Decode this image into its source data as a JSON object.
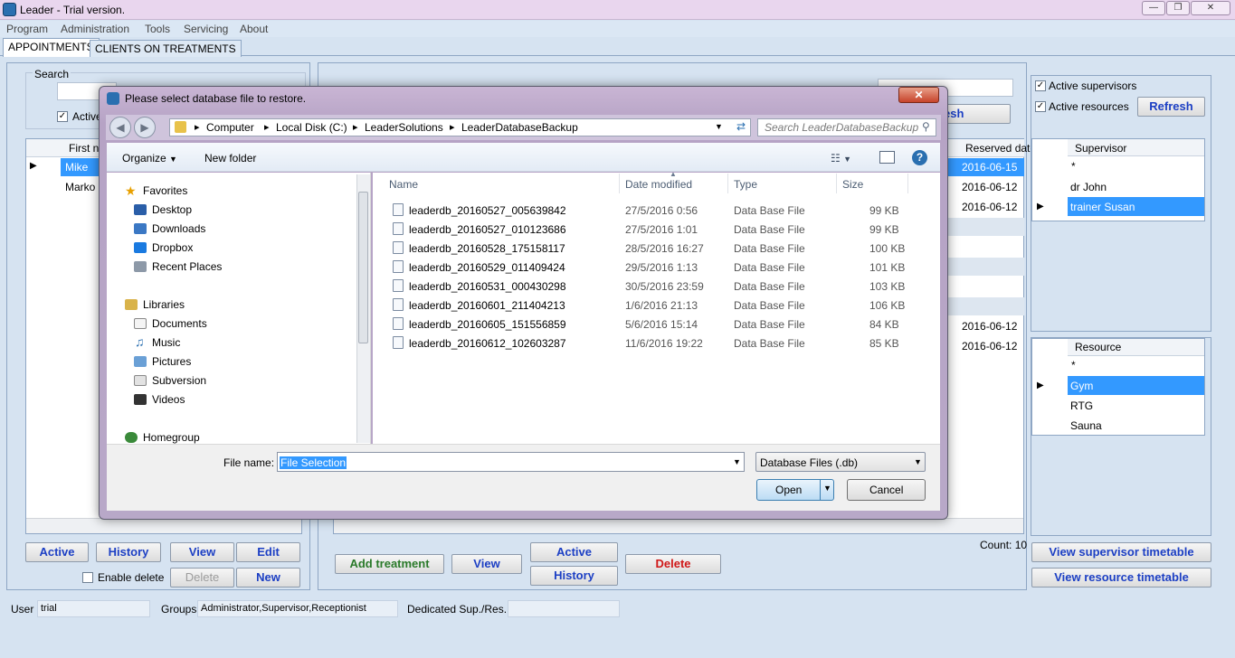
{
  "app": {
    "title": "Leader - Trial version."
  },
  "menu": [
    "Program",
    "Administration",
    "Tools",
    "Servicing",
    "About"
  ],
  "tabs": [
    "APPOINTMENTS",
    "CLIENTS ON TREATMENTS"
  ],
  "left_panel": {
    "search_label": "Search",
    "active_checkbox_label": "Active",
    "grid_header": "First na",
    "rows": [
      "Mike",
      "Marko"
    ],
    "buttons": {
      "active": "Active",
      "history": "History",
      "view": "View",
      "edit": "Edit",
      "delete": "Delete",
      "new": "New"
    },
    "enable_delete_label": "Enable delete"
  },
  "middle_panel": {
    "grid_header_reserved": "Reserved date",
    "reserved_dates": [
      "2016-06-15",
      "2016-06-12",
      "2016-06-12",
      "",
      "",
      "",
      "",
      "2016-06-12",
      "2016-06-12"
    ],
    "count_label": "Count: 10",
    "refresh_partial": "esh",
    "buttons": {
      "add_treatment": "Add treatment",
      "view": "View",
      "active": "Active",
      "history": "History",
      "delete": "Delete"
    }
  },
  "right_panel": {
    "active_supervisors_label": "Active supervisors",
    "active_resources_label": "Active resources",
    "refresh": "Refresh",
    "supervisor_header": "Supervisor",
    "supervisors": [
      "*",
      "dr John",
      "trainer Susan"
    ],
    "resource_header": "Resource",
    "resources": [
      "*",
      "Gym",
      "RTG",
      "Sauna"
    ],
    "view_supervisor_timetable": "View supervisor timetable",
    "view_resource_timetable": "View resource timetable"
  },
  "status": {
    "user_label": "User",
    "user_value": "trial",
    "groups_label": "Groups",
    "groups_value": "Administrator,Supervisor,Receptionist",
    "dedicated_label": "Dedicated Sup./Res.",
    "dedicated_value": ""
  },
  "dialog": {
    "title": "Please select database file to restore.",
    "breadcrumb": [
      "Computer",
      "Local Disk (C:)",
      "LeaderSolutions",
      "LeaderDatabaseBackup"
    ],
    "search_placeholder": "Search LeaderDatabaseBackup",
    "organize": "Organize",
    "new_folder": "New folder",
    "nav": {
      "favorites": "Favorites",
      "favorites_items": [
        "Desktop",
        "Downloads",
        "Dropbox",
        "Recent Places"
      ],
      "libraries": "Libraries",
      "libraries_items": [
        "Documents",
        "Music",
        "Pictures",
        "Subversion",
        "Videos"
      ],
      "homegroup": "Homegroup"
    },
    "columns": {
      "name": "Name",
      "date": "Date modified",
      "type": "Type",
      "size": "Size"
    },
    "files": [
      {
        "name": "leaderdb_20160527_005639842",
        "date": "27/5/2016 0:56",
        "type": "Data Base File",
        "size": "99 KB"
      },
      {
        "name": "leaderdb_20160527_010123686",
        "date": "27/5/2016 1:01",
        "type": "Data Base File",
        "size": "99 KB"
      },
      {
        "name": "leaderdb_20160528_175158117",
        "date": "28/5/2016 16:27",
        "type": "Data Base File",
        "size": "100 KB"
      },
      {
        "name": "leaderdb_20160529_011409424",
        "date": "29/5/2016 1:13",
        "type": "Data Base File",
        "size": "101 KB"
      },
      {
        "name": "leaderdb_20160531_000430298",
        "date": "30/5/2016 23:59",
        "type": "Data Base File",
        "size": "103 KB"
      },
      {
        "name": "leaderdb_20160601_211404213",
        "date": "1/6/2016 21:13",
        "type": "Data Base File",
        "size": "106 KB"
      },
      {
        "name": "leaderdb_20160605_151556859",
        "date": "5/6/2016 15:14",
        "type": "Data Base File",
        "size": "84 KB"
      },
      {
        "name": "leaderdb_20160612_102603287",
        "date": "11/6/2016 19:22",
        "type": "Data Base File",
        "size": "85 KB"
      }
    ],
    "file_name_label": "File name:",
    "file_name_value": "File Selection",
    "filter": "Database Files (.db)",
    "open": "Open",
    "cancel": "Cancel"
  }
}
